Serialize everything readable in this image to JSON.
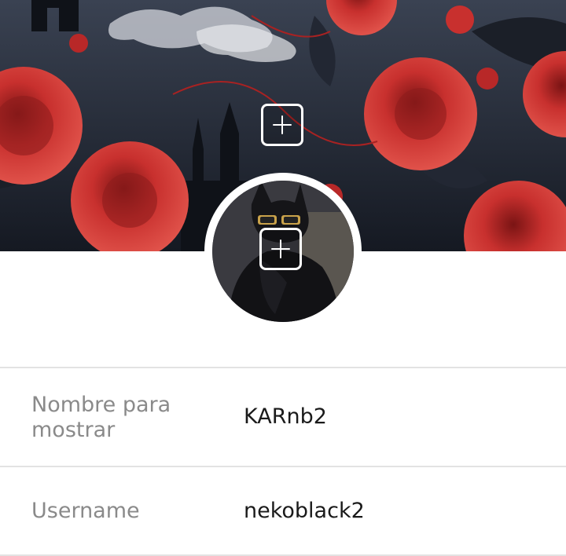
{
  "header": {
    "banner_image": "dark-roses-castle-banner",
    "banner_add_icon": "plus-icon",
    "avatar_image": "black-cat-sunglasses-avatar",
    "avatar_add_icon": "plus-icon"
  },
  "fields": [
    {
      "label": "Nombre para mostrar",
      "value": "KARnb2"
    },
    {
      "label": "Username",
      "value": "nekoblack2"
    }
  ],
  "colors": {
    "label": "#8a8a8a",
    "value": "#1a1a1a",
    "divider": "#e3e3e3",
    "rose": "#c8302e"
  }
}
